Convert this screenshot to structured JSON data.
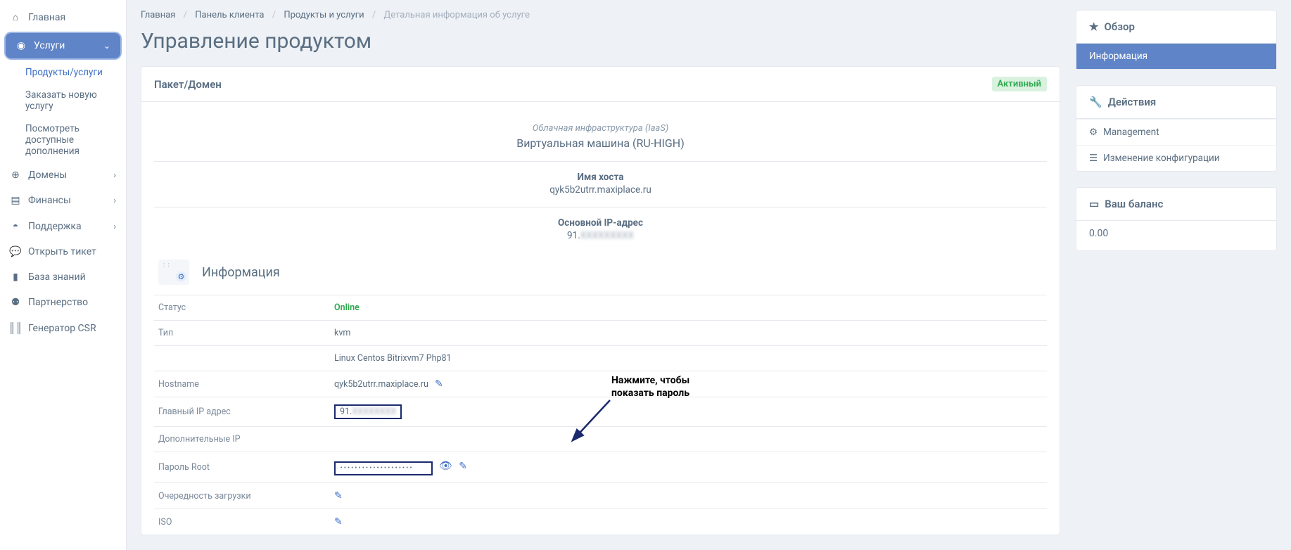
{
  "sidebar": {
    "home": "Главная",
    "services": "Услуги",
    "sub_products": "Продукты/услуги",
    "sub_order": "Заказать новую услугу",
    "sub_addons": "Посмотреть доступные дополнения",
    "domains": "Домены",
    "finance": "Финансы",
    "support": "Поддержка",
    "open_ticket": "Открыть тикет",
    "kb": "База знаний",
    "partnership": "Партнерство",
    "csr": "Генератор CSR"
  },
  "breadcrumb": {
    "home": "Главная",
    "panel": "Панель клиента",
    "products": "Продукты и услуги",
    "current": "Детальная информация об услуге"
  },
  "page_title": "Управление продуктом",
  "package_card": {
    "title": "Пакет/Домен",
    "status_badge": "Активный",
    "cloud_label": "Облачная инфраструктура (IaaS)",
    "machine": "Виртуальная машина (RU-HIGH)",
    "hostname_label": "Имя хоста",
    "hostname_value": "qyk5b2utrr.maxiplace.ru",
    "ip_label": "Основной IP-адрес",
    "ip_prefix": "91.",
    "ip_masked": "XXXXXXXXX"
  },
  "info_section": {
    "title": "Информация",
    "rows": {
      "status_label": "Статус",
      "status_value": "Online",
      "type_label": "Тип",
      "type_value": "kvm",
      "os_value": "Linux Centos Bitrixvm7 Php81",
      "hostname_label": "Hostname",
      "hostname_value": "qyk5b2utrr.maxiplace.ru",
      "main_ip_label": "Главный IP адрес",
      "main_ip_prefix": "91.",
      "extra_ip_label": "Дополнительные IP",
      "root_label": "Пароль Root",
      "root_value": "••••••••••••••••••••",
      "boot_label": "Очередность загрузки",
      "iso_label": "ISO"
    }
  },
  "annotation": {
    "line1": "Нажмите, чтобы",
    "line2": "показать пароль"
  },
  "aside": {
    "overview": "Обзор",
    "info": "Информация",
    "actions": "Действия",
    "management": "Management",
    "config_change": "Изменение конфигурации",
    "balance_title": "Ваш баланс",
    "balance_value": "0.00"
  }
}
